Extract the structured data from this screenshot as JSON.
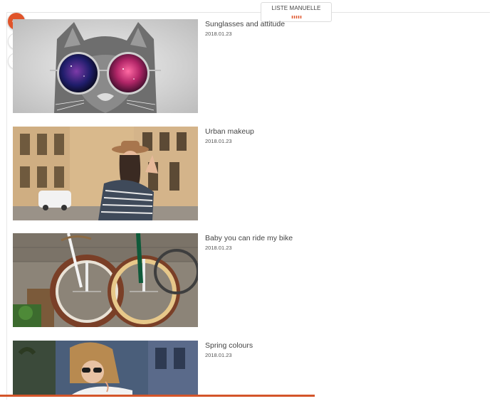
{
  "header": {
    "tab_label": "LISTE MANUELLE"
  },
  "toolbar": {
    "menu_icon": "more-horizontal-icon",
    "delete_icon": "trash-icon",
    "settings_icon": "gear-icon"
  },
  "colors": {
    "accent": "#e0542a",
    "divider": "#e4e4e4"
  },
  "items": [
    {
      "title": "Sunglasses and attitude",
      "date": "2018.01.23",
      "image": "cat-with-sunglasses-photo"
    },
    {
      "title": "Urban makeup",
      "date": "2018.01.23",
      "image": "woman-with-hat-in-street-photo"
    },
    {
      "title": "Baby you can ride my bike",
      "date": "2018.01.23",
      "image": "vintage-bicycles-photo"
    },
    {
      "title": "Spring colours",
      "date": "2018.01.23",
      "image": "woman-with-sunglasses-photo"
    }
  ]
}
